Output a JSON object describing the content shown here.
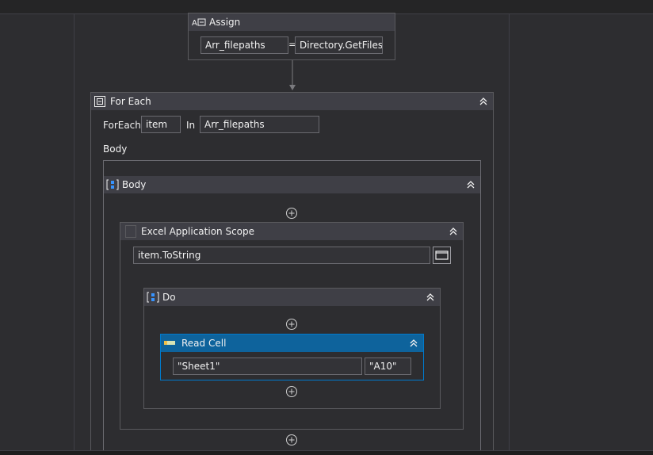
{
  "assign": {
    "title": "Assign",
    "to": "Arr_filepaths",
    "eq": "=",
    "value": "Directory.GetFiles(\""
  },
  "foreach": {
    "title": "For Each",
    "foreach_label": "ForEach",
    "item": "item",
    "in_label": "In",
    "collection": "Arr_filepaths",
    "body_label": "Body"
  },
  "body_seq": {
    "title": "Body"
  },
  "excel_scope": {
    "title": "Excel Application Scope",
    "path": "item.ToString"
  },
  "do_seq": {
    "title": "Do"
  },
  "read_cell": {
    "title": "Read Cell",
    "sheet": "\"Sheet1\"",
    "cell": "\"A10\""
  },
  "colors": {
    "background": "#2d2d30",
    "header": "#3f3f46",
    "selected_header": "#0e639c",
    "selected_border": "#007acc"
  }
}
